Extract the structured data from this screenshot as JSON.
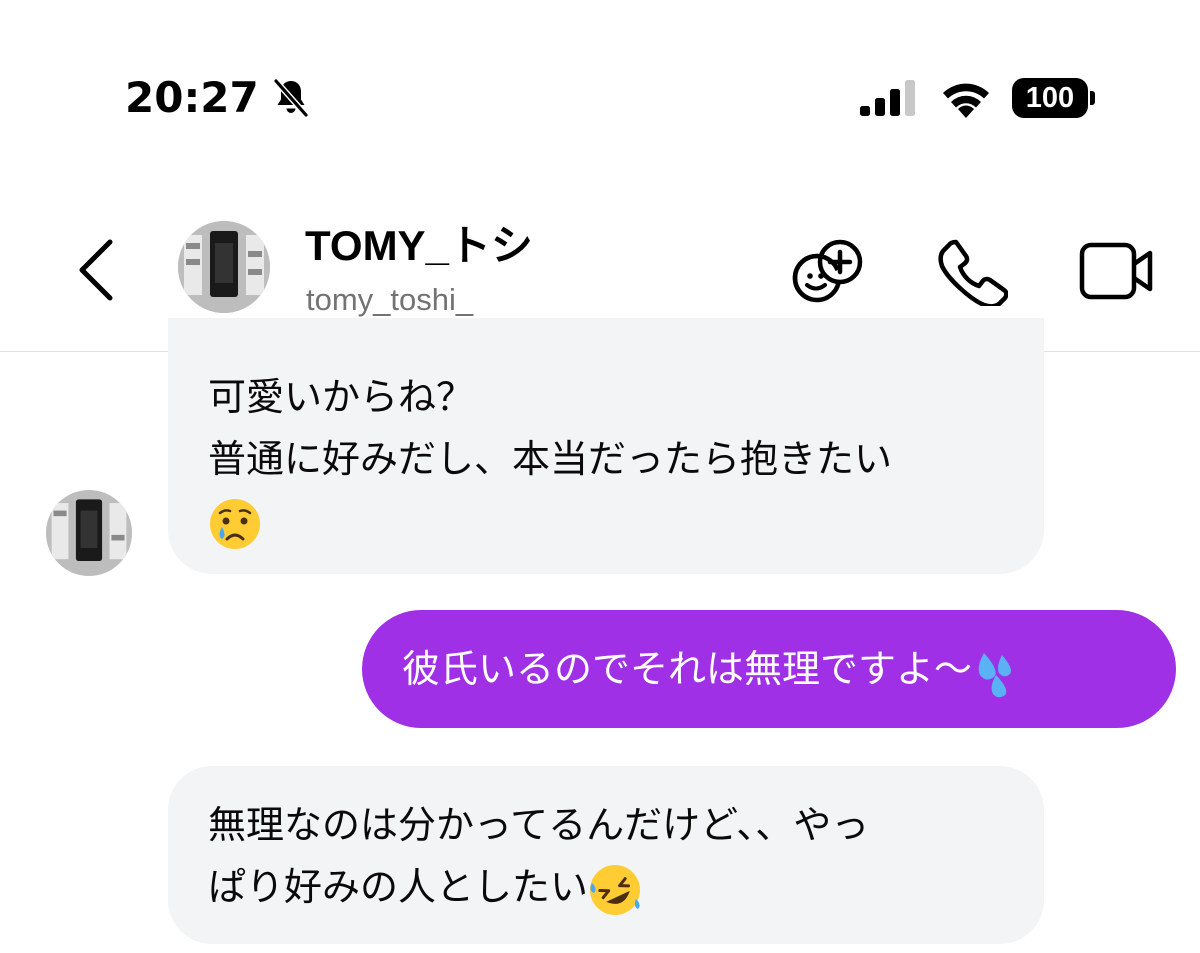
{
  "status_bar": {
    "time": "20:27",
    "battery": "100",
    "icons": [
      "bell-slash-icon",
      "signal-icon",
      "wifi-icon",
      "battery-icon"
    ]
  },
  "header": {
    "back_icon": "chevron-left-icon",
    "display_name": "TOMY_トシ",
    "username": "tomy_toshi_",
    "actions": [
      "effects-icon",
      "phone-icon",
      "video-camera-icon"
    ]
  },
  "messages": [
    {
      "direction": "incoming",
      "lines": [
        "可愛いからね？",
        "普通に好みだし、本当だったら抱きたい"
      ],
      "emoji": "crying-face-emoji"
    },
    {
      "direction": "outgoing",
      "text": "彼氏いるのでそれは無理ですよ〜",
      "emoji": "sweat-droplets-emoji"
    },
    {
      "direction": "incoming",
      "lines": [
        "無理なのは分かってるんだけど、、やっ",
        "ぱり好みの人としたい"
      ],
      "emoji": "rolling-on-floor-laughing-emoji"
    }
  ],
  "colors": {
    "outgoing_bubble": "#9f30e6",
    "incoming_bubble": "#f3f4f6",
    "username_gray": "#737373"
  }
}
